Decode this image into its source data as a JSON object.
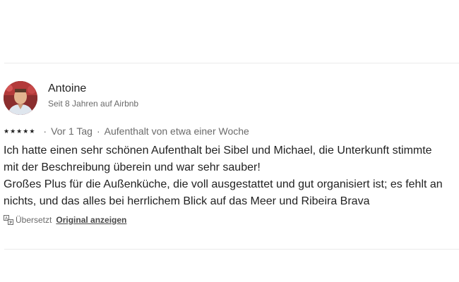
{
  "review": {
    "reviewer_name": "Antoine",
    "reviewer_meta": "Seit 8 Jahren auf Airbnb",
    "rating": 5,
    "date": "Vor 1 Tag",
    "stay_duration": "Aufenthalt von etwa einer Woche",
    "text_lines": [
      "Ich hatte einen sehr schönen Aufenthalt bei Sibel und Michael, die Unterkunft stimmte",
      "mit der Beschreibung überein und war sehr sauber!",
      "Großes Plus für die Außenküche, die voll ausgestattet und gut organisiert ist; es fehlt an",
      "nichts, und das alles bei herrlichem Blick auf das Meer und Ribeira Brava"
    ],
    "translated_label": "Übersetzt",
    "show_original_label": "Original anzeigen"
  },
  "separator": "·",
  "colors": {
    "text_primary": "#222222",
    "text_secondary": "#6a6a6a",
    "divider": "#ebebeb"
  }
}
